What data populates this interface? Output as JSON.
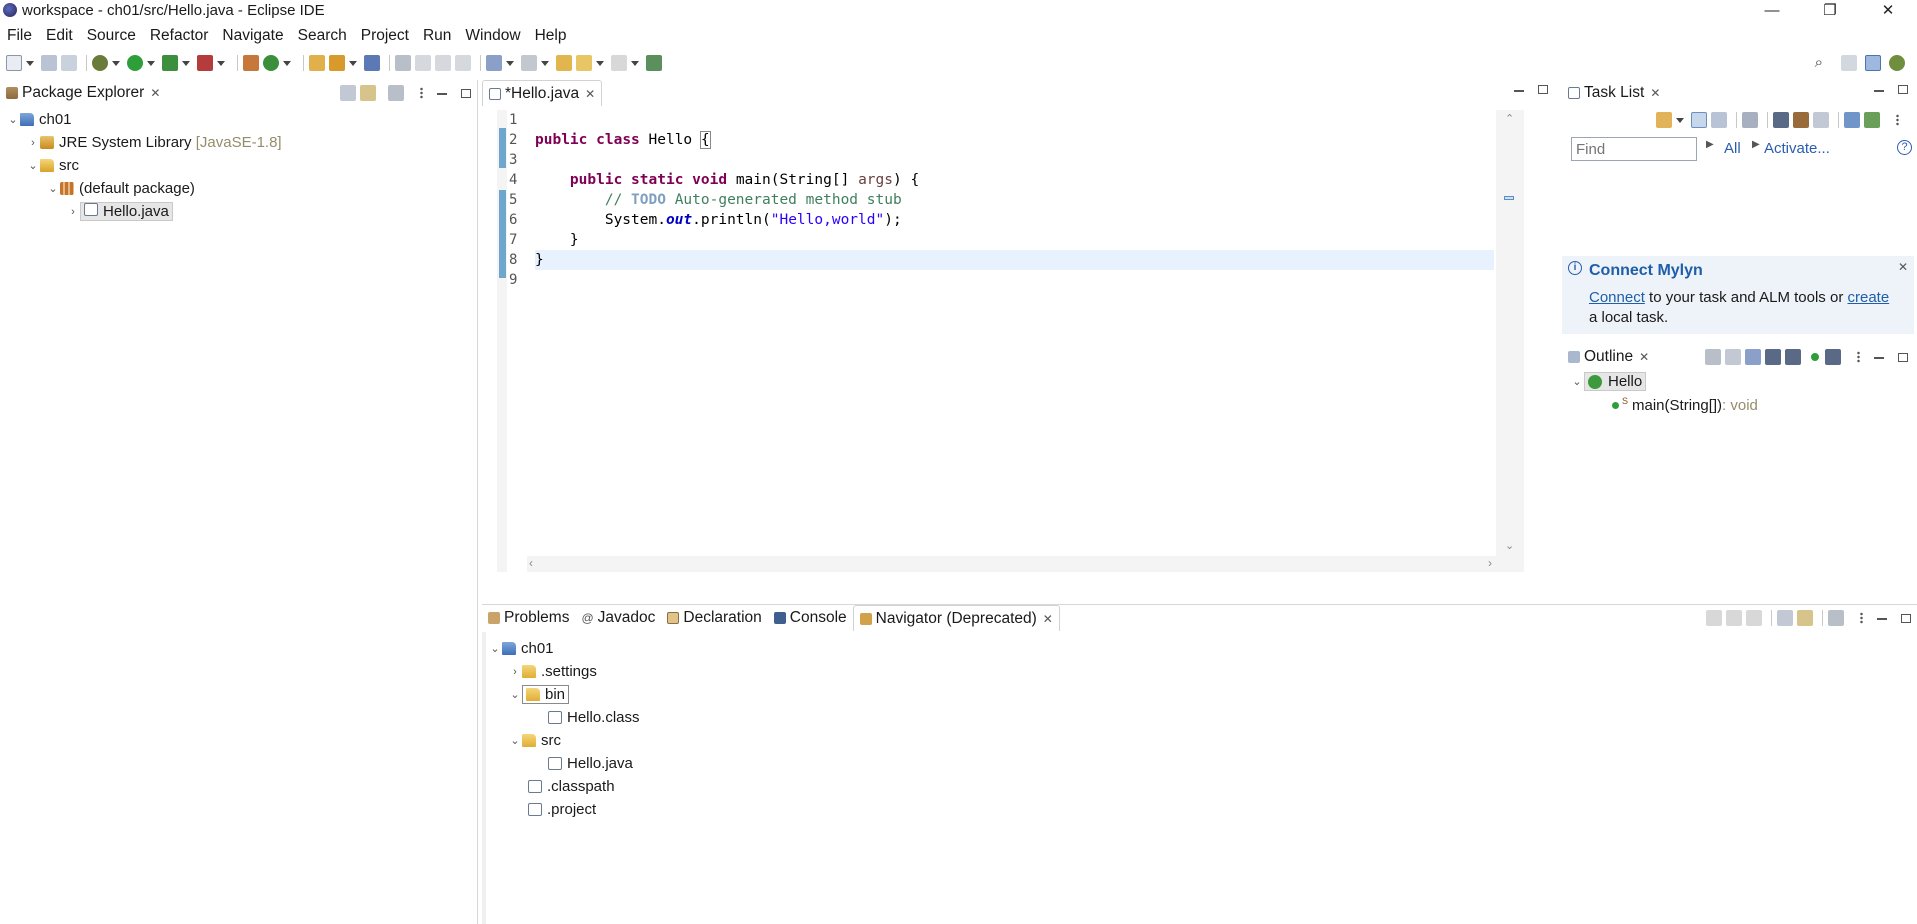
{
  "window": {
    "title": "workspace - ch01/src/Hello.java - Eclipse IDE",
    "controls": [
      "—",
      "❐",
      "✕"
    ]
  },
  "menu": [
    "File",
    "Edit",
    "Source",
    "Refactor",
    "Navigate",
    "Search",
    "Project",
    "Run",
    "Window",
    "Help"
  ],
  "package_explorer": {
    "title": "Package Explorer",
    "tree": {
      "project": "ch01",
      "jre": "JRE System Library",
      "jre_version": "[JavaSE-1.8]",
      "src": "src",
      "default_package": "(default package)",
      "file": "Hello.java"
    }
  },
  "editor": {
    "tab": "*Hello.java",
    "line_numbers": [
      "1",
      "2",
      "3",
      "4",
      "5",
      "6",
      "7",
      "8",
      "9"
    ],
    "code": {
      "l2_kw1": "public",
      "l2_kw2": "class",
      "l2_name": "Hello",
      "l2_brace": "{",
      "l4_kw1": "public",
      "l4_kw2": "static",
      "l4_kw3": "void",
      "l4_sig": "main(String[]",
      "l4_param": "args",
      "l4_end": ") {",
      "l5_comment_start": "// ",
      "l5_todo": "TODO",
      "l5_comment_rest": " Auto-generated method stub",
      "l6_start": "System.",
      "l6_field": "out",
      "l6_call": ".println(",
      "l6_str": "\"Hello,world\"",
      "l6_end": ");",
      "l7": "}",
      "l8": "}"
    }
  },
  "task_list": {
    "title": "Task List",
    "find_placeholder": "Find",
    "all_label": "All",
    "activate_label": "Activate..."
  },
  "mylyn": {
    "title": "Connect Mylyn",
    "link1": "Connect",
    "text1": " to your task and ALM tools or ",
    "link2": "create",
    "text2": "a local task."
  },
  "outline": {
    "title": "Outline",
    "class_name": "Hello",
    "method_name": "main(String[])",
    "method_type": " : void",
    "method_modifier": "S"
  },
  "bottom": {
    "tabs": [
      "Problems",
      "Javadoc",
      "Declaration",
      "Console",
      "Navigator (Deprecated)"
    ],
    "navigator": {
      "project": "ch01",
      "settings": ".settings",
      "bin": "bin",
      "bin_file": "Hello.class",
      "src": "src",
      "src_file": "Hello.java",
      "classpath": ".classpath",
      "project_file": ".project"
    }
  },
  "colors": {
    "accent_blue": "#3e6fb6",
    "keyword": "#7f0055",
    "comment": "#3f7f5f",
    "string": "#2a00ff",
    "current_line": "#e8f2fe"
  }
}
